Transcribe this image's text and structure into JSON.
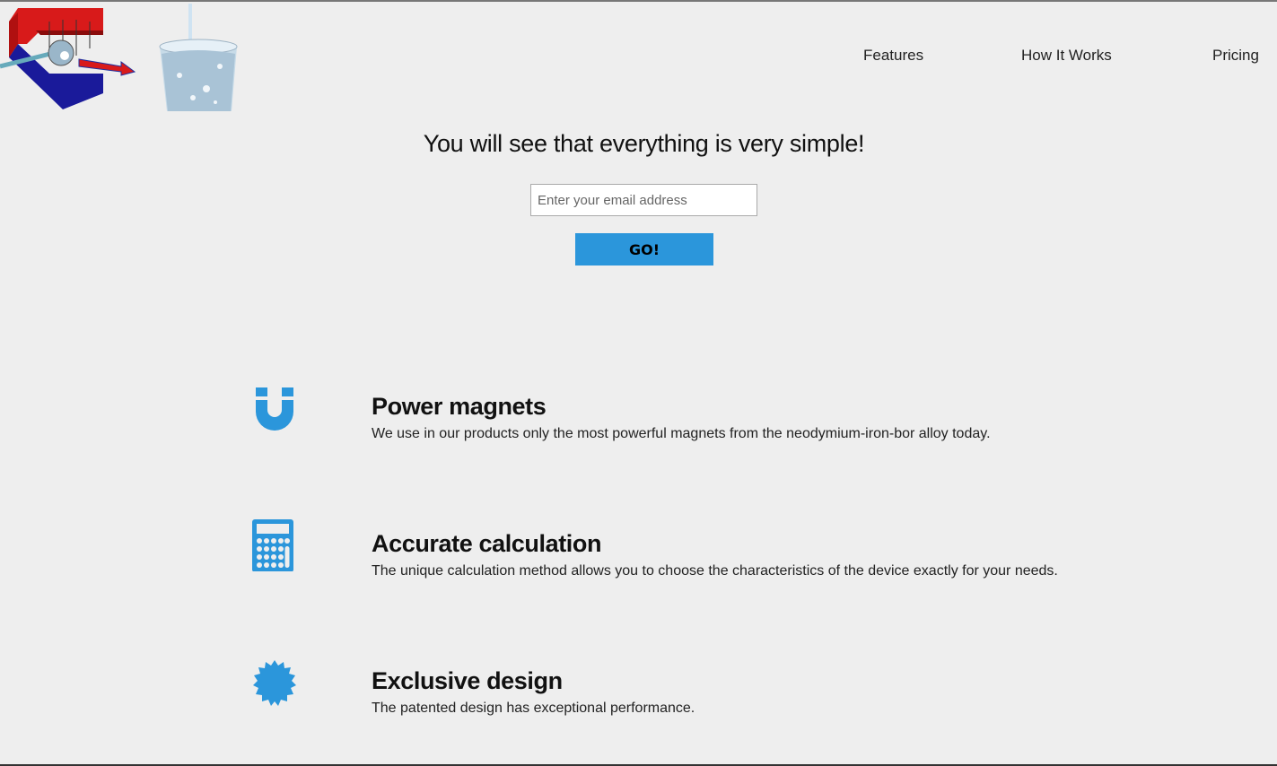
{
  "nav": {
    "items": [
      {
        "label": "Features"
      },
      {
        "label": "How It Works"
      },
      {
        "label": "Pricing"
      }
    ]
  },
  "hero": {
    "title": "You will see that everything is very simple!",
    "email_placeholder": "Enter your email address",
    "go_label": "GO!"
  },
  "features": [
    {
      "icon": "magnet-icon",
      "title": "Power magnets",
      "description": "We use in our products only the most powerful magnets from the neodymium-iron-bor alloy today."
    },
    {
      "icon": "calculator-icon",
      "title": "Accurate calculation",
      "description": "The unique calculation method allows you to choose the characteristics of the device exactly for your needs."
    },
    {
      "icon": "badge-icon",
      "title": "Exclusive design",
      "description": "The patented design has exceptional performance."
    }
  ],
  "colors": {
    "accent": "#2b96db",
    "background": "#eeeeee"
  }
}
